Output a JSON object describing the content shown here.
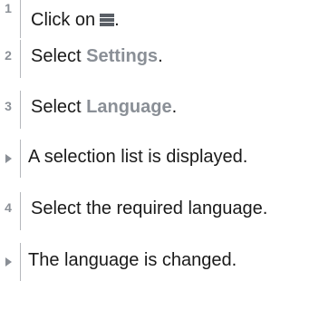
{
  "steps": [
    {
      "number": "1",
      "text": "Click on",
      "icon": "menu-icon",
      "suffix": "."
    },
    {
      "number": "2",
      "prefix": "Select ",
      "keyword": "Settings",
      "suffix": "."
    },
    {
      "number": "3",
      "prefix": "Select ",
      "keyword": "Language",
      "suffix": "."
    },
    {
      "result": "A selection list is displayed."
    },
    {
      "number": "4",
      "text": "Select the required language."
    },
    {
      "result": "The language is changed."
    }
  ],
  "colors": {
    "accent": "#8a8f96",
    "rule": "#b5b8bc",
    "text": "#1a1a1a"
  }
}
